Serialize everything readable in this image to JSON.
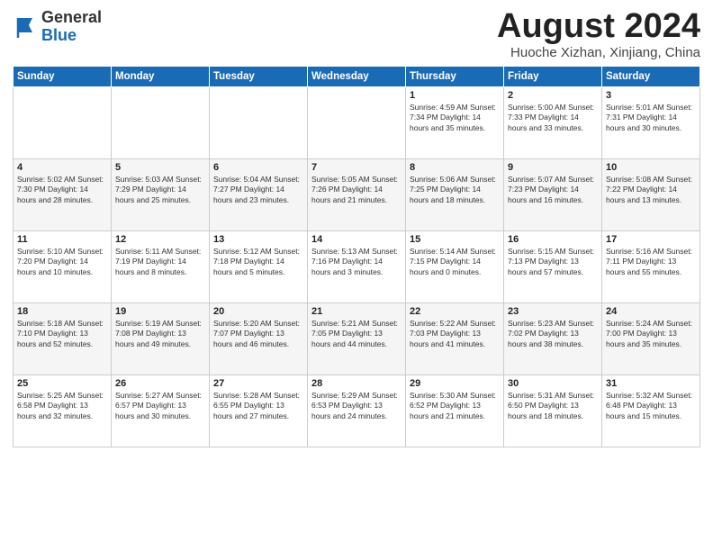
{
  "header": {
    "logo_general": "General",
    "logo_blue": "Blue",
    "month_title": "August 2024",
    "location": "Huoche Xizhan, Xinjiang, China"
  },
  "weekdays": [
    "Sunday",
    "Monday",
    "Tuesday",
    "Wednesday",
    "Thursday",
    "Friday",
    "Saturday"
  ],
  "weeks": [
    [
      {
        "day": "",
        "info": ""
      },
      {
        "day": "",
        "info": ""
      },
      {
        "day": "",
        "info": ""
      },
      {
        "day": "",
        "info": ""
      },
      {
        "day": "1",
        "info": "Sunrise: 4:59 AM\nSunset: 7:34 PM\nDaylight: 14 hours\nand 35 minutes."
      },
      {
        "day": "2",
        "info": "Sunrise: 5:00 AM\nSunset: 7:33 PM\nDaylight: 14 hours\nand 33 minutes."
      },
      {
        "day": "3",
        "info": "Sunrise: 5:01 AM\nSunset: 7:31 PM\nDaylight: 14 hours\nand 30 minutes."
      }
    ],
    [
      {
        "day": "4",
        "info": "Sunrise: 5:02 AM\nSunset: 7:30 PM\nDaylight: 14 hours\nand 28 minutes."
      },
      {
        "day": "5",
        "info": "Sunrise: 5:03 AM\nSunset: 7:29 PM\nDaylight: 14 hours\nand 25 minutes."
      },
      {
        "day": "6",
        "info": "Sunrise: 5:04 AM\nSunset: 7:27 PM\nDaylight: 14 hours\nand 23 minutes."
      },
      {
        "day": "7",
        "info": "Sunrise: 5:05 AM\nSunset: 7:26 PM\nDaylight: 14 hours\nand 21 minutes."
      },
      {
        "day": "8",
        "info": "Sunrise: 5:06 AM\nSunset: 7:25 PM\nDaylight: 14 hours\nand 18 minutes."
      },
      {
        "day": "9",
        "info": "Sunrise: 5:07 AM\nSunset: 7:23 PM\nDaylight: 14 hours\nand 16 minutes."
      },
      {
        "day": "10",
        "info": "Sunrise: 5:08 AM\nSunset: 7:22 PM\nDaylight: 14 hours\nand 13 minutes."
      }
    ],
    [
      {
        "day": "11",
        "info": "Sunrise: 5:10 AM\nSunset: 7:20 PM\nDaylight: 14 hours\nand 10 minutes."
      },
      {
        "day": "12",
        "info": "Sunrise: 5:11 AM\nSunset: 7:19 PM\nDaylight: 14 hours\nand 8 minutes."
      },
      {
        "day": "13",
        "info": "Sunrise: 5:12 AM\nSunset: 7:18 PM\nDaylight: 14 hours\nand 5 minutes."
      },
      {
        "day": "14",
        "info": "Sunrise: 5:13 AM\nSunset: 7:16 PM\nDaylight: 14 hours\nand 3 minutes."
      },
      {
        "day": "15",
        "info": "Sunrise: 5:14 AM\nSunset: 7:15 PM\nDaylight: 14 hours\nand 0 minutes."
      },
      {
        "day": "16",
        "info": "Sunrise: 5:15 AM\nSunset: 7:13 PM\nDaylight: 13 hours\nand 57 minutes."
      },
      {
        "day": "17",
        "info": "Sunrise: 5:16 AM\nSunset: 7:11 PM\nDaylight: 13 hours\nand 55 minutes."
      }
    ],
    [
      {
        "day": "18",
        "info": "Sunrise: 5:18 AM\nSunset: 7:10 PM\nDaylight: 13 hours\nand 52 minutes."
      },
      {
        "day": "19",
        "info": "Sunrise: 5:19 AM\nSunset: 7:08 PM\nDaylight: 13 hours\nand 49 minutes."
      },
      {
        "day": "20",
        "info": "Sunrise: 5:20 AM\nSunset: 7:07 PM\nDaylight: 13 hours\nand 46 minutes."
      },
      {
        "day": "21",
        "info": "Sunrise: 5:21 AM\nSunset: 7:05 PM\nDaylight: 13 hours\nand 44 minutes."
      },
      {
        "day": "22",
        "info": "Sunrise: 5:22 AM\nSunset: 7:03 PM\nDaylight: 13 hours\nand 41 minutes."
      },
      {
        "day": "23",
        "info": "Sunrise: 5:23 AM\nSunset: 7:02 PM\nDaylight: 13 hours\nand 38 minutes."
      },
      {
        "day": "24",
        "info": "Sunrise: 5:24 AM\nSunset: 7:00 PM\nDaylight: 13 hours\nand 35 minutes."
      }
    ],
    [
      {
        "day": "25",
        "info": "Sunrise: 5:25 AM\nSunset: 6:58 PM\nDaylight: 13 hours\nand 32 minutes."
      },
      {
        "day": "26",
        "info": "Sunrise: 5:27 AM\nSunset: 6:57 PM\nDaylight: 13 hours\nand 30 minutes."
      },
      {
        "day": "27",
        "info": "Sunrise: 5:28 AM\nSunset: 6:55 PM\nDaylight: 13 hours\nand 27 minutes."
      },
      {
        "day": "28",
        "info": "Sunrise: 5:29 AM\nSunset: 6:53 PM\nDaylight: 13 hours\nand 24 minutes."
      },
      {
        "day": "29",
        "info": "Sunrise: 5:30 AM\nSunset: 6:52 PM\nDaylight: 13 hours\nand 21 minutes."
      },
      {
        "day": "30",
        "info": "Sunrise: 5:31 AM\nSunset: 6:50 PM\nDaylight: 13 hours\nand 18 minutes."
      },
      {
        "day": "31",
        "info": "Sunrise: 5:32 AM\nSunset: 6:48 PM\nDaylight: 13 hours\nand 15 minutes."
      }
    ]
  ]
}
